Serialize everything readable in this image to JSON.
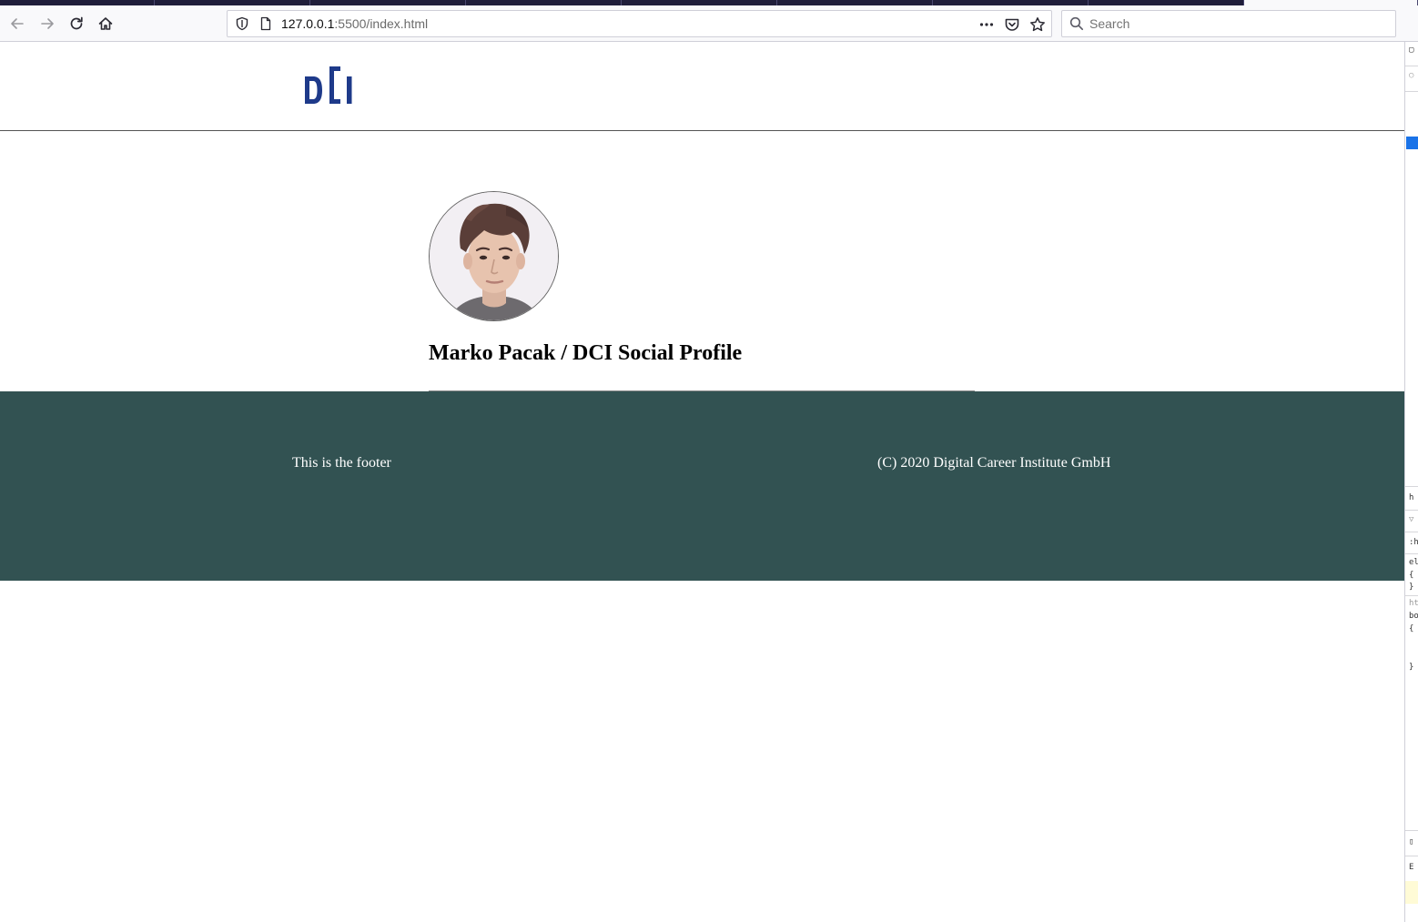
{
  "browser": {
    "url_host": "127.0.0.1",
    "url_rest": ":5500/index.html",
    "search_placeholder": "Search",
    "tabs_count_visible": 8
  },
  "site": {
    "logo_text": "DCI",
    "profile_title": "Marko Pacak / DCI Social Profile",
    "avatar_alt": "Marko Pacak",
    "footer_left": "This is the footer",
    "footer_right": "(C) 2020 Digital Career Institute GmbH",
    "colors": {
      "logo": "#1e3a8a",
      "footer_bg": "#325252",
      "footer_text": "#ffffff"
    }
  },
  "devtools": {
    "lines": [
      "h",
      ":h",
      "el",
      "{",
      "}",
      "ht",
      "bo",
      "{",
      "}",
      "E"
    ]
  }
}
